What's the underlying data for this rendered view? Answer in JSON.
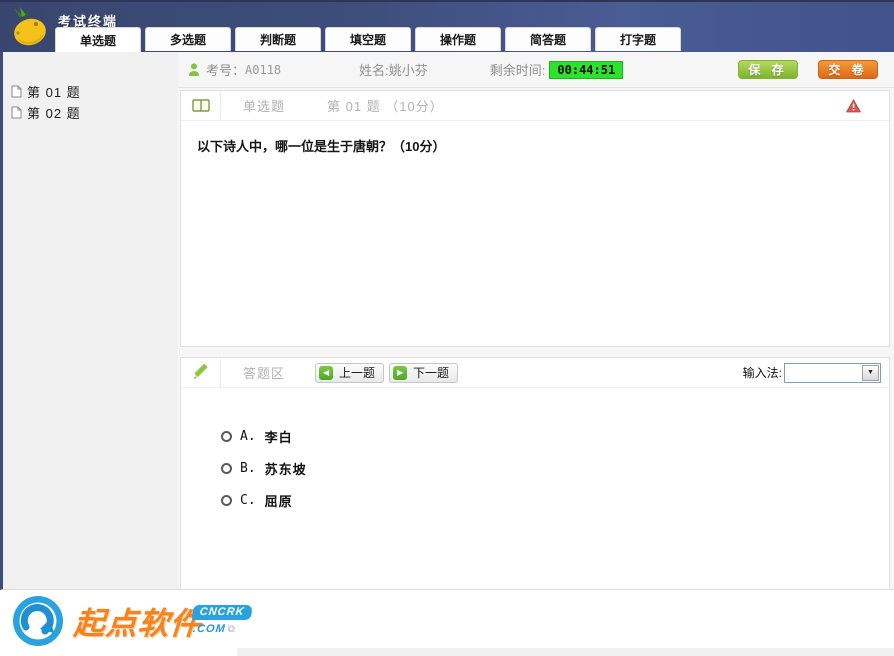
{
  "window": {
    "title": "考试终端"
  },
  "tabs": [
    {
      "label": "单选题",
      "active": true
    },
    {
      "label": "多选题"
    },
    {
      "label": "判断题"
    },
    {
      "label": "填空题"
    },
    {
      "label": "操作题"
    },
    {
      "label": "简答题"
    },
    {
      "label": "打字题"
    }
  ],
  "info_bar": {
    "exam_no_label": "考号：",
    "exam_no": "A0118",
    "name_label": "姓名:",
    "name": "姚小芬",
    "time_label": "剩余时间:",
    "time_remaining": "00:44:51",
    "save_label": "保 存",
    "submit_label": "交 卷"
  },
  "sidebar": {
    "items": [
      {
        "label": "第 01 题"
      },
      {
        "label": "第 02 题"
      }
    ]
  },
  "question_panel": {
    "type_label": "单选题",
    "number_label": "第 01 题 （10分）",
    "question_text": "以下诗人中，哪一位是生于唐朝？（10分）"
  },
  "answer_panel": {
    "header_label": "答题区",
    "prev_label": "上一题",
    "next_label": "下一题",
    "ime_label": "输入法:",
    "ime_value": "",
    "options": [
      {
        "key": "A.",
        "text": "李白"
      },
      {
        "key": "B.",
        "text": "苏东坡"
      },
      {
        "key": "C.",
        "text": "屈原"
      }
    ]
  },
  "footer": {
    "brand_text": "起点软件",
    "badge_top": "CNCRK",
    "badge_bottom": ".COM"
  },
  "icons": {
    "prev_arrow": "◀",
    "next_arrow": "▶",
    "dropdown_arrow": "▼",
    "external": "⧉"
  },
  "colors": {
    "titlebar_navy": "#3f4d7c",
    "time_green": "#2ce32c",
    "save_green": "#7cb42e",
    "submit_orange": "#e06717",
    "brand_orange": "#f5831f",
    "badge_blue": "#29a3e0",
    "accent_green": "#5cb832"
  }
}
